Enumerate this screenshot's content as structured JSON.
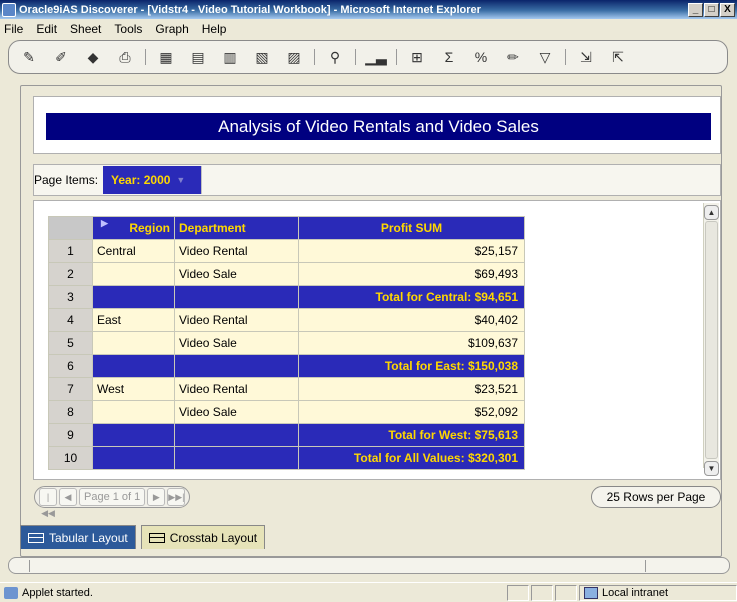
{
  "window": {
    "title": "Oracle9iAS Discoverer - [Vidstr4 - Video Tutorial Workbook] - Microsoft Internet Explorer",
    "controls": [
      "_",
      "□",
      "X"
    ]
  },
  "menu": [
    "File",
    "Edit",
    "Sheet",
    "Tools",
    "Graph",
    "Help"
  ],
  "toolbar_icons": [
    "new-workbook-icon",
    "open-icon",
    "edit-icon",
    "print-icon",
    "edit-sheet-icon",
    "table-icon",
    "crosstab-icon",
    "graph-wizard-icon",
    "pivot-icon",
    "drill-icon",
    "bar-chart-icon",
    "totals-icon",
    "sum-icon",
    "percent-icon",
    "calculation-icon",
    "filter-icon",
    "export-icon",
    "help-icon"
  ],
  "report": {
    "title": "Analysis of Video Rentals and Video Sales",
    "page_items_label": "Page Items:",
    "page_item_value": "Year: 2000"
  },
  "table": {
    "headers": {
      "region": "Region",
      "department": "Department",
      "profit": "Profit SUM"
    },
    "rows": [
      {
        "n": "1",
        "region": "Central",
        "department": "Video Rental",
        "profit": "$25,157",
        "total": false
      },
      {
        "n": "2",
        "region": "",
        "department": "Video Sale",
        "profit": "$69,493",
        "total": false
      },
      {
        "n": "3",
        "region": "",
        "department": "",
        "profit": "Total for Central: $94,651",
        "total": true
      },
      {
        "n": "4",
        "region": "East",
        "department": "Video Rental",
        "profit": "$40,402",
        "total": false
      },
      {
        "n": "5",
        "region": "",
        "department": "Video Sale",
        "profit": "$109,637",
        "total": false
      },
      {
        "n": "6",
        "region": "",
        "department": "",
        "profit": "Total for East: $150,038",
        "total": true
      },
      {
        "n": "7",
        "region": "West",
        "department": "Video Rental",
        "profit": "$23,521",
        "total": false
      },
      {
        "n": "8",
        "region": "",
        "department": "Video Sale",
        "profit": "$52,092",
        "total": false
      },
      {
        "n": "9",
        "region": "",
        "department": "",
        "profit": "Total for West: $75,613",
        "total": true
      },
      {
        "n": "10",
        "region": "",
        "department": "",
        "profit": "Total for All Values: $320,301",
        "total": true
      }
    ]
  },
  "pager": {
    "page_label": "Page 1 of 1",
    "rows_per_page": "25 Rows per Page"
  },
  "tabs": [
    {
      "label": "Tabular Layout",
      "active": true
    },
    {
      "label": "Crosstab Layout",
      "active": false
    }
  ],
  "status": {
    "text": "Applet started.",
    "zone": "Local intranet"
  },
  "colors": {
    "header_bg": "#2a2ab8",
    "header_text": "#ffd800",
    "banner_bg": "#000080",
    "cell_bg": "#fff9d8"
  }
}
